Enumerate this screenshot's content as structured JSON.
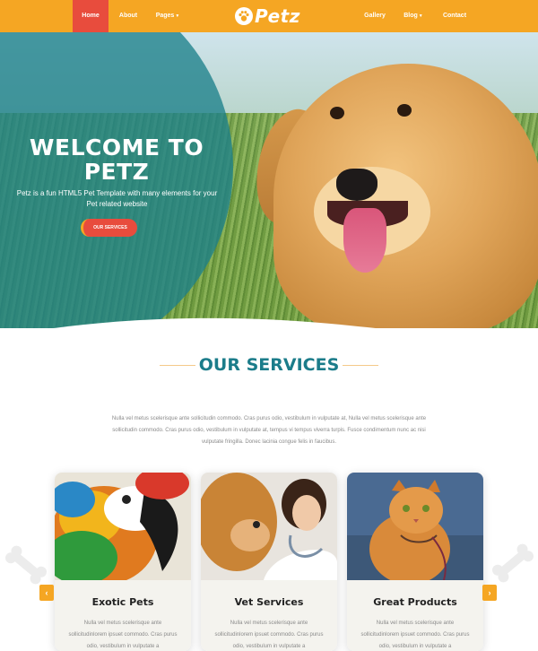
{
  "nav": {
    "items_left": [
      {
        "label": "Home",
        "active": true
      },
      {
        "label": "About",
        "active": false
      },
      {
        "label": "Pages",
        "active": false,
        "dropdown": true
      }
    ],
    "items_right": [
      {
        "label": "Gallery",
        "active": false
      },
      {
        "label": "Blog",
        "active": false,
        "dropdown": true
      },
      {
        "label": "Contact",
        "active": false
      }
    ],
    "logo_text": "Petz",
    "logo_icon": "paw-icon"
  },
  "hero": {
    "title_line1": "WELCOME TO",
    "title_line2": "PETZ",
    "subtitle": "Petz is a fun HTML5 Pet Template with many elements for your Pet related website",
    "button_label": "OUR SERVICES",
    "image": "golden-retriever-puppy"
  },
  "services": {
    "title": "OUR SERVICES",
    "description": "Nulla vel metus scelerisque ante sollicitudin commodo. Cras purus odio, vestibulum in vulputate at, Nulla vel metus scelerisque ante sollicitudin commodo. Cras purus odio, vestibulum in vulputate at, tempus vi tempus viverra turpis. Fusce condimentum nunc ac nisi vulputate fringilla. Donec lacinia congue felis in faucibus.",
    "cards": [
      {
        "title": "Exotic Pets",
        "text": "Nulla vel metus scelerisque ante sollicitudinlorem ipsuet commodo. Cras purus odio, vestibulum in vulputate a",
        "image": "parrot"
      },
      {
        "title": "Vet Services",
        "text": "Nulla vel metus scelerisque ante sollicitudinlorem ipsuet commodo. Cras purus odio, vestibulum in vulputate a",
        "image": "vet-with-dog"
      },
      {
        "title": "Great Products",
        "text": "Nulla vel metus scelerisque ante sollicitudinlorem ipsuet commodo. Cras purus odio, vestibulum in vulputate a",
        "image": "cat-on-leash"
      }
    ],
    "prev_icon": "chevron-left-icon",
    "next_icon": "chevron-right-icon"
  },
  "colors": {
    "brand_orange": "#f5a623",
    "accent_red": "#e84c3d",
    "teal": "#1b7c8a"
  }
}
